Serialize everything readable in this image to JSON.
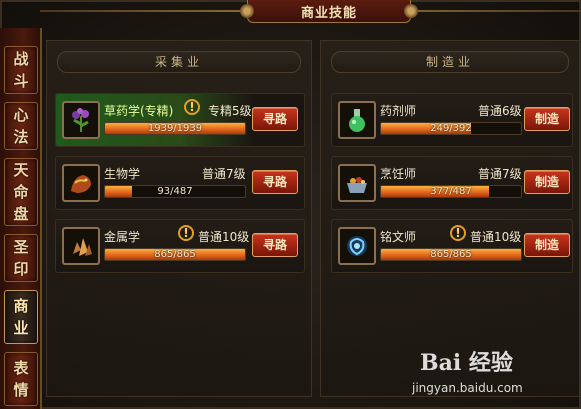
{
  "window": {
    "title": "商业技能"
  },
  "tabs": [
    {
      "label": "战斗",
      "chars": [
        "战",
        "斗"
      ]
    },
    {
      "label": "心法",
      "chars": [
        "心",
        "法"
      ]
    },
    {
      "label": "天命盘",
      "chars": [
        "天",
        "命",
        "盘"
      ]
    },
    {
      "label": "圣印",
      "chars": [
        "圣",
        "印"
      ]
    },
    {
      "label": "商业",
      "chars": [
        "商",
        "业"
      ]
    },
    {
      "label": "表情",
      "chars": [
        "表",
        "情"
      ]
    }
  ],
  "gathering": {
    "header": "采集业",
    "skills": [
      {
        "name": "草药学(专精)",
        "level": "专精5级",
        "progress": "1939/1939",
        "fill": 1.0,
        "button": "寻路",
        "icon": "herb-icon",
        "warning": "!"
      },
      {
        "name": "生物学",
        "level": "普通7级",
        "progress": "93/487",
        "fill": 0.19,
        "button": "寻路",
        "icon": "beast-icon"
      },
      {
        "name": "金属学",
        "level": "普通10级",
        "progress": "865/865",
        "fill": 1.0,
        "button": "寻路",
        "icon": "ore-icon",
        "warning": "!"
      }
    ]
  },
  "crafting": {
    "header": "制造业",
    "skills": [
      {
        "name": "药剂师",
        "level": "普通6级",
        "progress": "249/392",
        "fill": 0.64,
        "button": "制造",
        "icon": "potion-icon"
      },
      {
        "name": "烹饪师",
        "level": "普通7级",
        "progress": "377/487",
        "fill": 0.77,
        "button": "制造",
        "icon": "cooking-icon"
      },
      {
        "name": "铭文师",
        "level": "普通10级",
        "progress": "865/865",
        "fill": 1.0,
        "button": "制造",
        "icon": "rune-icon",
        "warning": "!"
      }
    ]
  },
  "watermark": {
    "logo": "Bai 经验",
    "url": "jingyan.baidu.com"
  }
}
